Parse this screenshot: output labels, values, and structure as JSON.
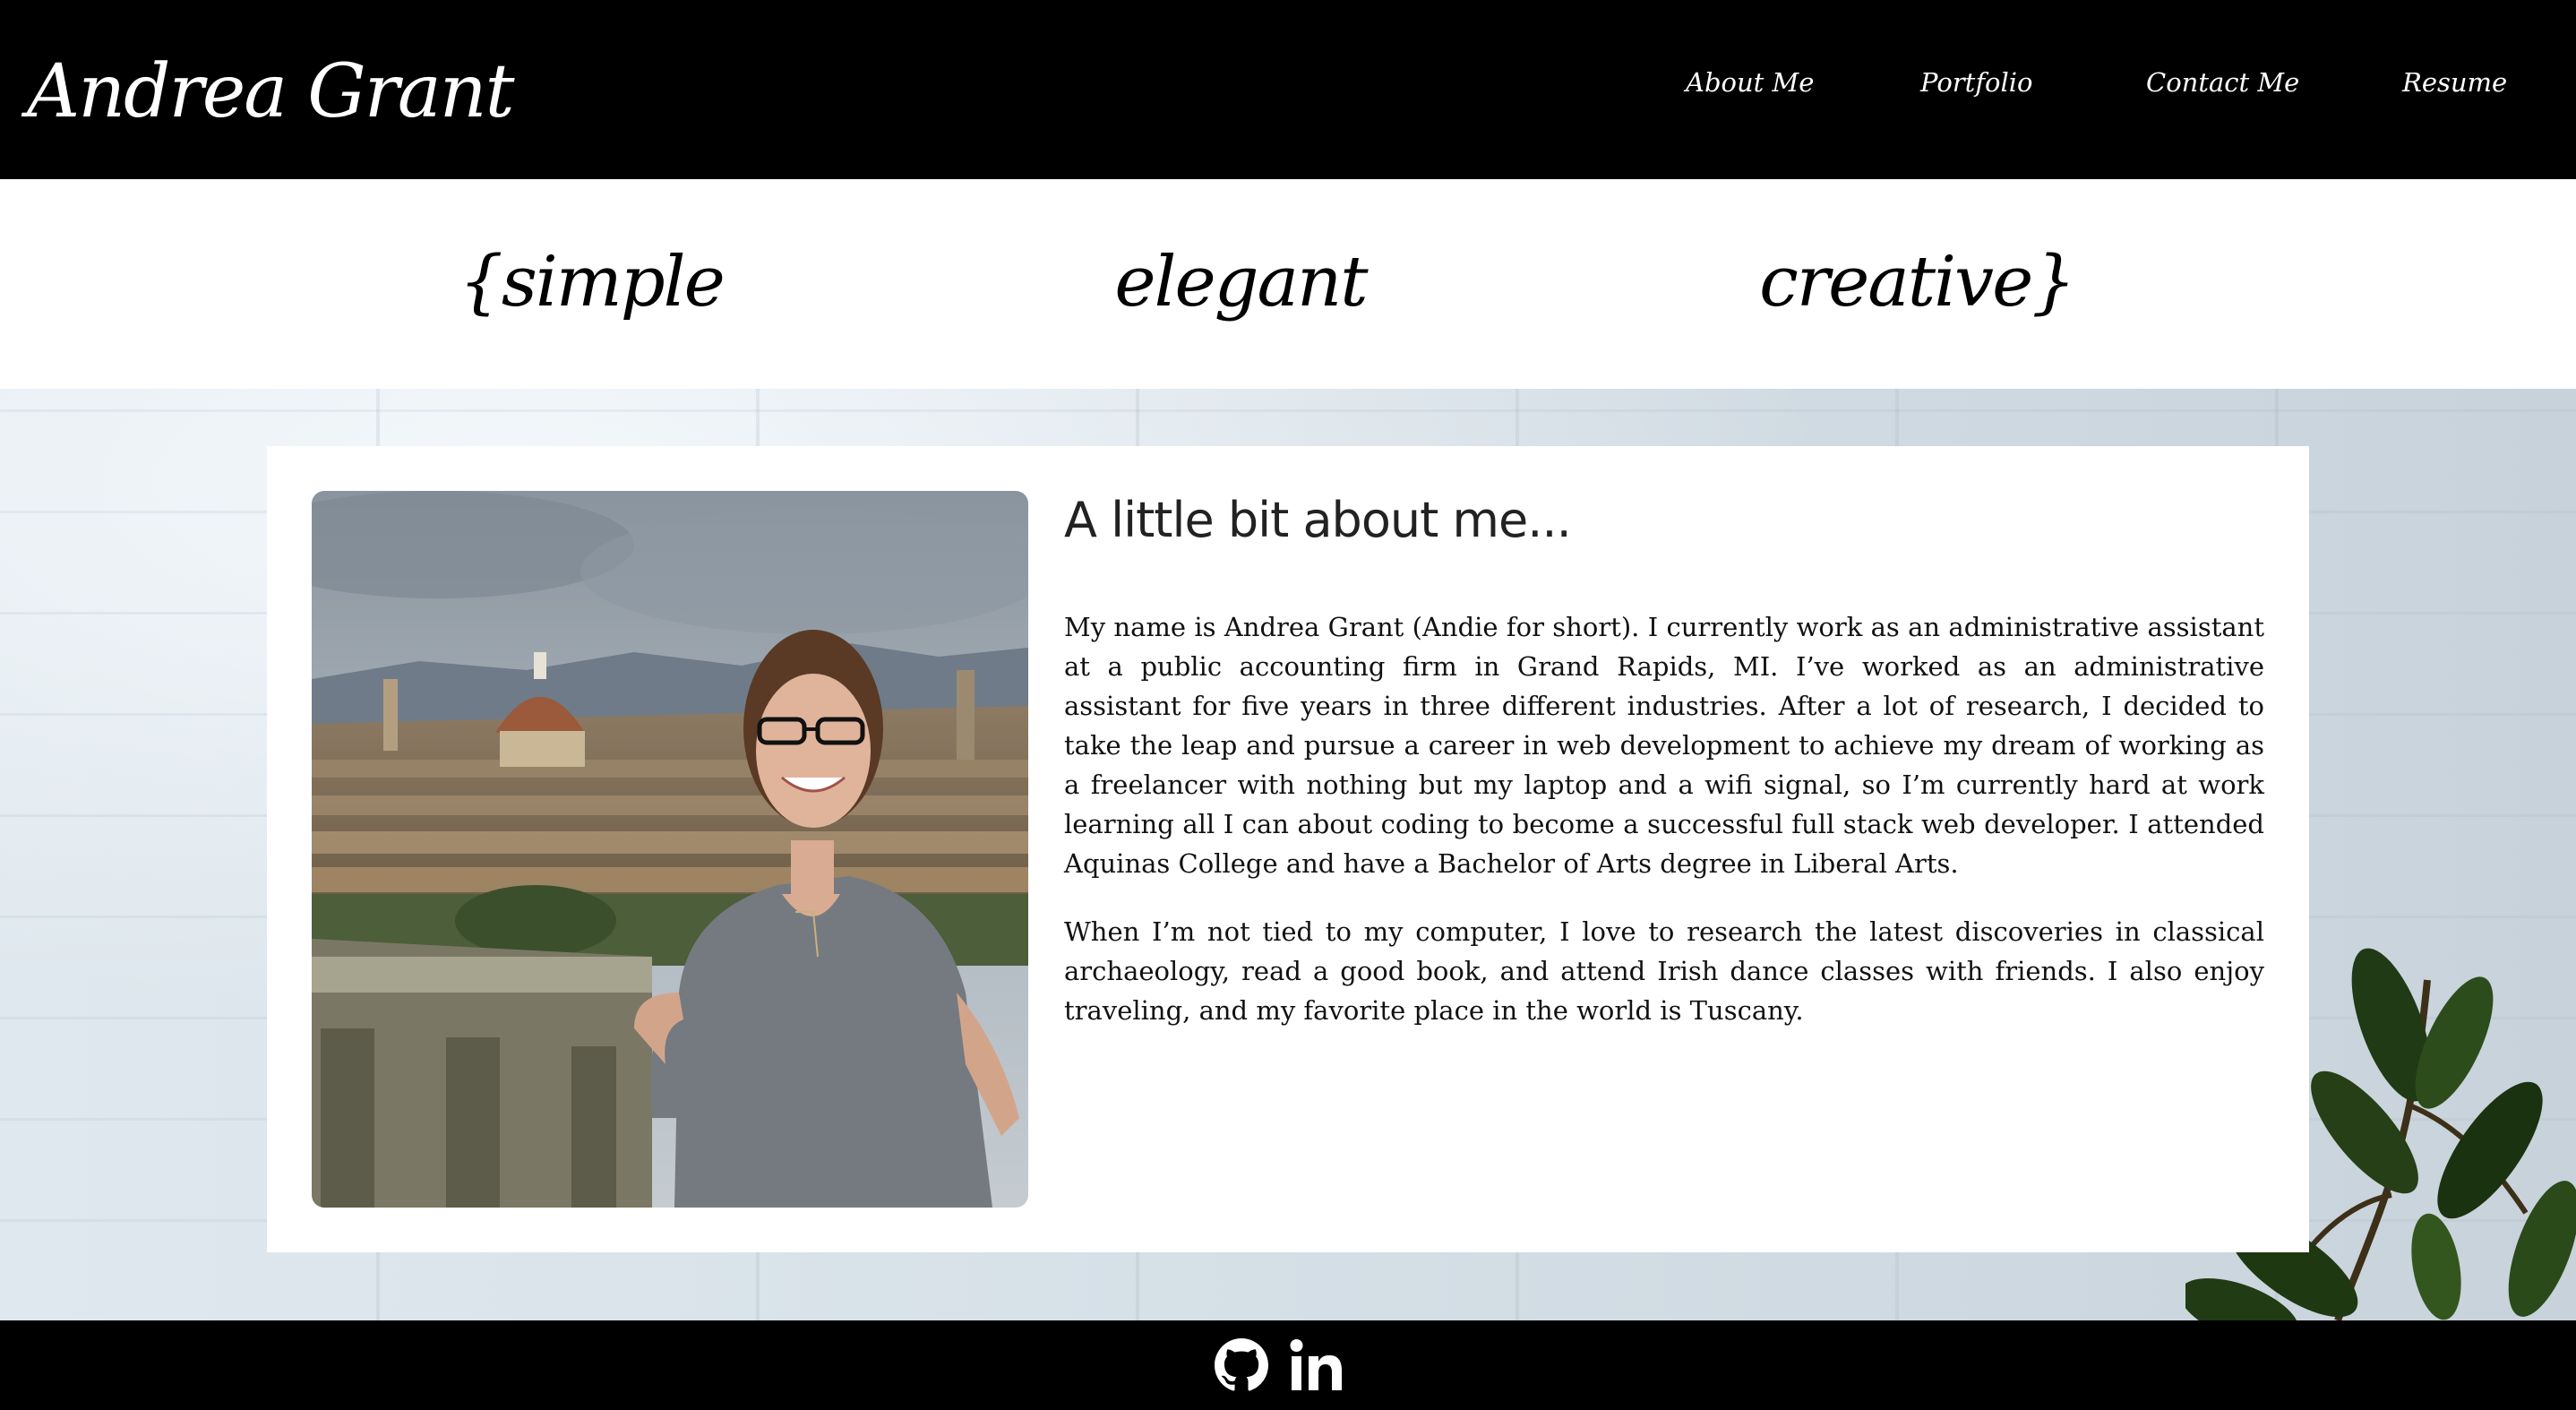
{
  "header": {
    "brand": "Andrea Grant",
    "nav": [
      {
        "label": "About Me"
      },
      {
        "label": "Portfolio"
      },
      {
        "label": "Contact Me"
      },
      {
        "label": "Resume"
      }
    ]
  },
  "tagline": {
    "words": [
      "{simple",
      "elegant",
      "creative}"
    ]
  },
  "about": {
    "heading": "A little bit about me...",
    "paragraphs": [
      "My name is Andrea Grant (Andie for short). I currently work as an administrative assistant at a public accounting firm in Grand Rapids, MI. I’ve worked as an administrative assistant for five years in three different industries. After a lot of research, I decided to take the leap and pursue a career in web development to achieve my dream of working as a freelancer with nothing but my laptop and a wifi signal, so I’m currently hard at work learning all I can about coding to become a successful full stack web developer. I attended Aquinas College and have a Bachelor of Arts degree in Liberal Arts.",
      "When I’m not tied to my computer, I love to research the latest discoveries in classical archaeology, read a good book, and attend Irish dance classes with friends. I also enjoy traveling, and my favorite place in the world is Tuscany."
    ]
  },
  "footer": {
    "icons": [
      "github-icon",
      "linkedin-icon"
    ]
  },
  "colors": {
    "header_bg": "#000000",
    "footer_bg": "#000000",
    "card_bg": "#ffffff",
    "heading_text": "#222222"
  }
}
